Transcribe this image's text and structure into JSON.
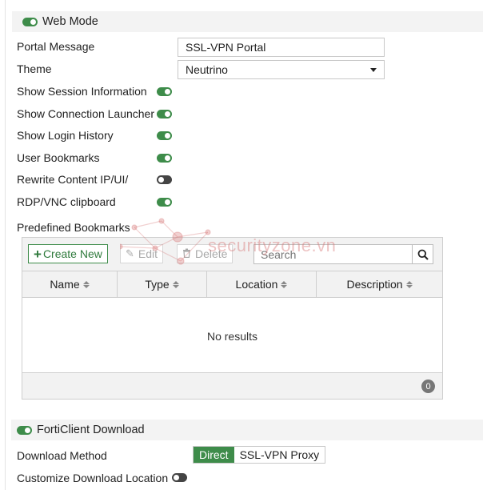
{
  "web_mode": {
    "title": "Web Mode",
    "enabled": true,
    "portal_message": {
      "label": "Portal Message",
      "value": "SSL-VPN Portal"
    },
    "theme": {
      "label": "Theme",
      "value": "Neutrino"
    },
    "options": [
      {
        "label": "Show Session Information",
        "enabled": true
      },
      {
        "label": "Show Connection Launcher",
        "enabled": true
      },
      {
        "label": "Show Login History",
        "enabled": true
      },
      {
        "label": "User Bookmarks",
        "enabled": true
      },
      {
        "label": "Rewrite Content IP/UI/",
        "enabled": false
      },
      {
        "label": "RDP/VNC clipboard",
        "enabled": true
      }
    ],
    "predefined_bookmarks": {
      "label": "Predefined Bookmarks",
      "toolbar": {
        "create_new": "Create New",
        "edit": "Edit",
        "delete": "Delete",
        "search_placeholder": "Search"
      },
      "columns": [
        "Name",
        "Type",
        "Location",
        "Description"
      ],
      "empty_text": "No results",
      "count": "0"
    }
  },
  "forticlient_download": {
    "title": "FortiClient Download",
    "enabled": true,
    "download_method": {
      "label": "Download Method",
      "options": [
        "Direct",
        "SSL-VPN Proxy"
      ],
      "selected": "Direct"
    },
    "customize_location": {
      "label": "Customize Download Location",
      "enabled": false
    }
  },
  "watermark_text": "securityzone.vn",
  "colors": {
    "accent_green": "#3e8c4a",
    "header_bg": "#f3f3f3"
  }
}
